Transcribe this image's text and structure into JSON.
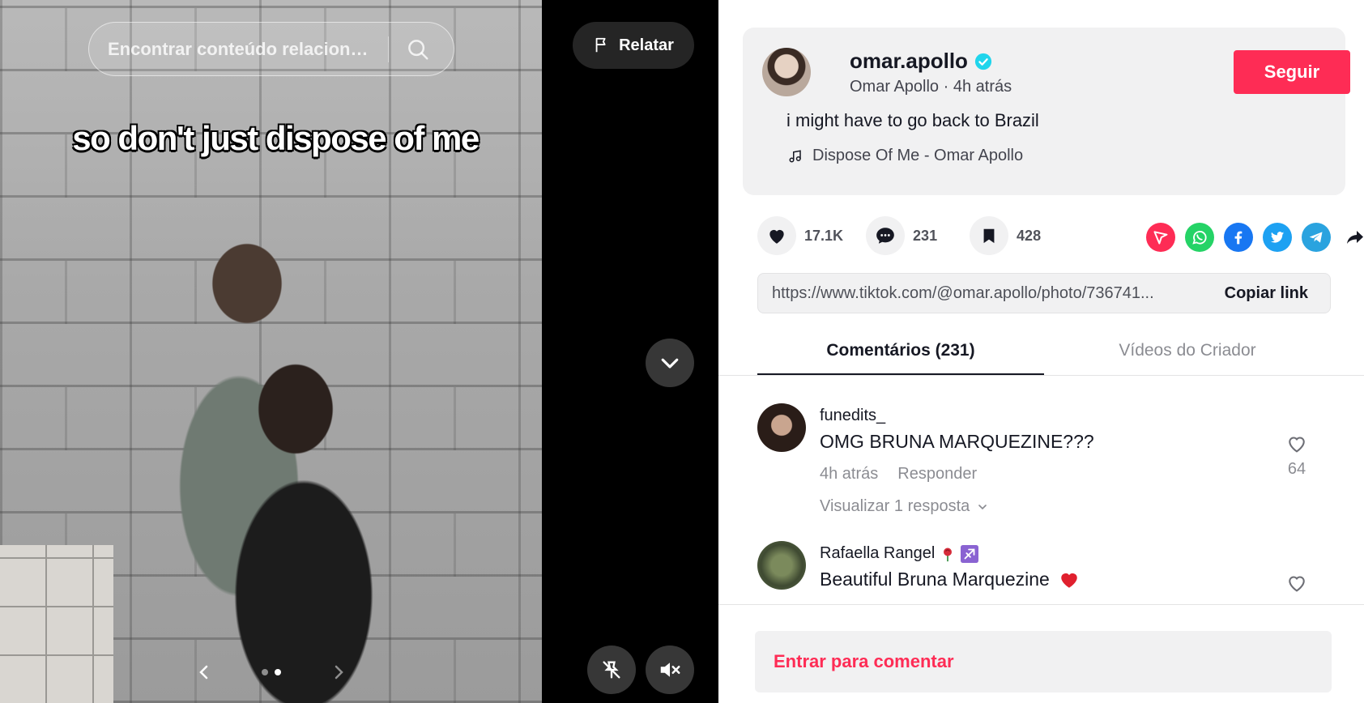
{
  "search": {
    "placeholder": "Encontrar conteúdo relacionado"
  },
  "media": {
    "caption_overlay": "so don't just dispose of me",
    "report_label": "Relatar",
    "carousel": {
      "total": 2,
      "active_index": 1
    }
  },
  "post": {
    "username": "omar.apollo",
    "display_name": "Omar Apollo",
    "time_ago": "4h atrás",
    "separator": " · ",
    "follow_label": "Seguir",
    "description": "i might have to go back to Brazil",
    "music": "Dispose Of Me - Omar Apollo"
  },
  "actions": {
    "likes": "17.1K",
    "comments": "231",
    "saves": "428",
    "share_icons": [
      "share-red-icon",
      "whatsapp-icon",
      "facebook-icon",
      "twitter-icon",
      "telegram-icon",
      "share-arrow-icon"
    ],
    "colors": {
      "like": "#161823",
      "share_red": "#fe2c55",
      "whatsapp": "#25d366",
      "facebook": "#1877f2",
      "twitter": "#1da1f2",
      "telegram": "#2aa3df"
    }
  },
  "link": {
    "url": "https://www.tiktok.com/@omar.apollo/photo/736741...",
    "copy_label": "Copiar link"
  },
  "tabs": [
    {
      "label": "Comentários (231)",
      "active": true
    },
    {
      "label": "Vídeos do Criador",
      "active": false
    }
  ],
  "comments": [
    {
      "user": "funedits_",
      "text": "OMG BRUNA MARQUEZINE???",
      "time": "4h atrás",
      "reply_label": "Responder",
      "view_replies": "Visualizar 1 resposta",
      "likes": "64"
    },
    {
      "user": "Rafaella Rangel",
      "text": "Beautiful Bruna Marquezine"
    }
  ],
  "comment_bar": {
    "login_label": "Entrar para comentar"
  },
  "colors": {
    "accent": "#fe2c55",
    "verified": "#20d5ec"
  }
}
